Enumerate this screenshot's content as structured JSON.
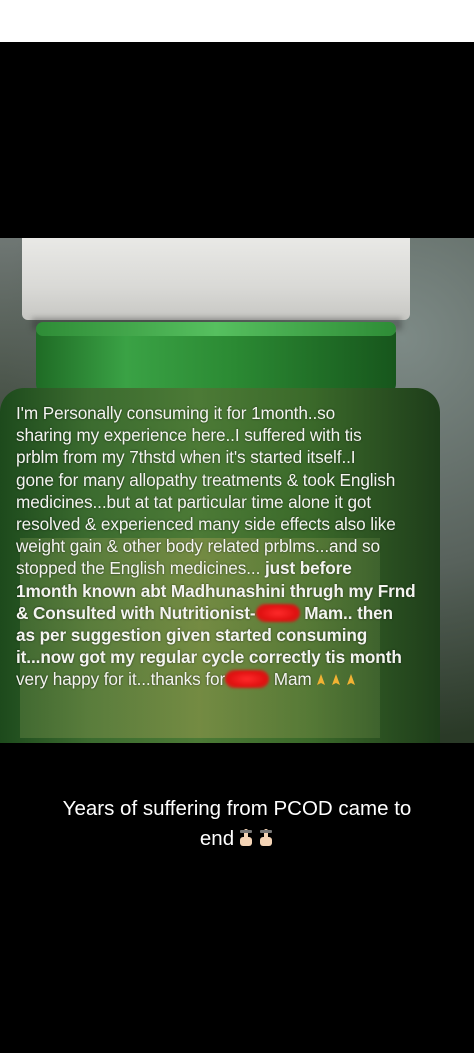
{
  "post": {
    "overlay_lines": [
      {
        "text": "I'm Personally consuming it for 1month..so"
      },
      {
        "text": "sharing my experience here..I suffered with tis"
      },
      {
        "text": "prblm from my 7thstd when it's started itself..I"
      },
      {
        "text": "gone for many allopathy treatments & took English"
      },
      {
        "text": "medicines...but at tat particular time alone it got"
      },
      {
        "text": "resolved & experienced many side effects also like"
      },
      {
        "text": "weight gain & other body related prblms...and so"
      }
    ],
    "line8_a": "stopped the English medicines... ",
    "line8_b": "just before",
    "line9": "1month known abt Madhunashini thrugh my Frnd",
    "line10_a": "& Consulted with Nutritionist-",
    "line10_b": " Mam.. then",
    "line11": "as per suggestion given started consuming",
    "line12": "it...now got my regular cycle correctly tis month",
    "line13_a": "very happy for it...thanks for",
    "line13_b": " Mam",
    "caption_line1": "Years of suffering from PCOD came to",
    "caption_line2": "end",
    "icons": [
      "folded-hands-icon",
      "pointing-down-icon"
    ],
    "colors": {
      "background": "#000000",
      "text": "#ffffff",
      "redaction": "#e01010"
    }
  }
}
